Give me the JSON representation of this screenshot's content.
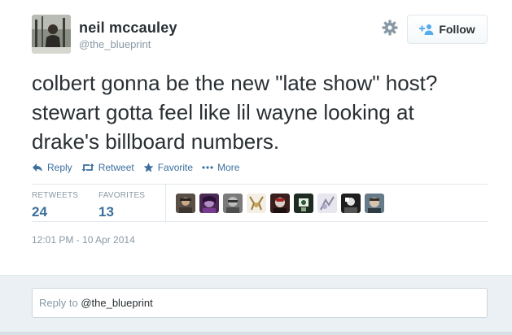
{
  "author": {
    "name": "neil mccauley",
    "handle": "@the_blueprint"
  },
  "header": {
    "follow_label": "Follow",
    "settings_icon": "gear-icon",
    "follow_icon": "add-person-icon"
  },
  "tweet": {
    "lines": [
      "colbert gonna be the new \"late show\" host?",
      "stewart gotta feel like lil wayne looking at",
      "drake's billboard numbers."
    ]
  },
  "actions": [
    {
      "label": "Reply",
      "icon": "reply-arrow-icon"
    },
    {
      "label": "Retweet",
      "icon": "retweet-icon"
    },
    {
      "label": "Favorite",
      "icon": "star-icon"
    },
    {
      "label": "More",
      "icon": "ellipsis-icon"
    }
  ],
  "stats": {
    "retweets_label": "RETWEETS",
    "retweets": "24",
    "favorites_label": "FAVORITES",
    "favorites": "13"
  },
  "favoriter_avatars": [
    {
      "color": "#5a4f46"
    },
    {
      "color": "#4a2a55"
    },
    {
      "color": "#7a7a7a"
    },
    {
      "color": "#e9dfc9"
    },
    {
      "color": "#3a1e1e"
    },
    {
      "color": "#1f2a20"
    },
    {
      "color": "#c9c6d2"
    },
    {
      "color": "#1e1e1e"
    },
    {
      "color": "#667b8a"
    }
  ],
  "timestamp": "12:01 PM - 10 Apr 2014",
  "reply": {
    "prefix": "Reply to",
    "handle": "@the_blueprint"
  },
  "colors": {
    "link": "#3b6f9e",
    "text": "#292f33",
    "muted": "#8899a6"
  }
}
